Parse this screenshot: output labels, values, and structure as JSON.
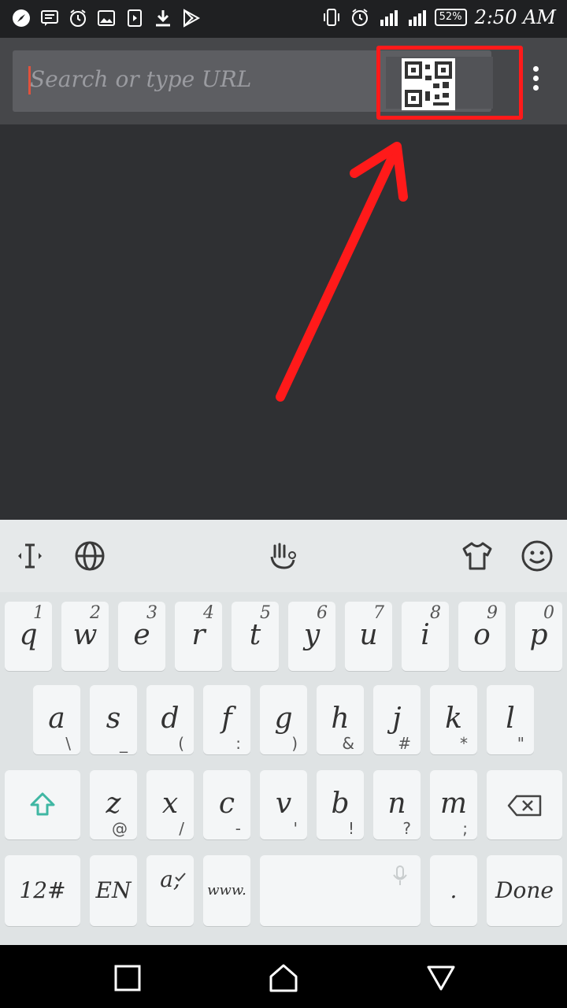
{
  "status_bar": {
    "left_icons": [
      "compass-icon",
      "message-icon",
      "alarm-icon",
      "image-icon",
      "media-icon",
      "download-icon",
      "play-store-icon"
    ],
    "battery": "52%",
    "time": "2:50 AM"
  },
  "browser": {
    "url_placeholder": "Search or type URL"
  },
  "keyboard": {
    "toolbar_icons": [
      "cursor-icon",
      "globe-icon",
      "swipe-hand-icon",
      "theme-shirt-icon",
      "emoji-icon"
    ],
    "row1": [
      {
        "main": "q",
        "sub": "1"
      },
      {
        "main": "w",
        "sub": "2"
      },
      {
        "main": "e",
        "sub": "3"
      },
      {
        "main": "r",
        "sub": "4"
      },
      {
        "main": "t",
        "sub": "5"
      },
      {
        "main": "y",
        "sub": "6"
      },
      {
        "main": "u",
        "sub": "7"
      },
      {
        "main": "i",
        "sub": "8"
      },
      {
        "main": "o",
        "sub": "9"
      },
      {
        "main": "p",
        "sub": "0"
      }
    ],
    "row2": [
      {
        "main": "a",
        "sub": "\\"
      },
      {
        "main": "s",
        "sub": "_"
      },
      {
        "main": "d",
        "sub": "("
      },
      {
        "main": "f",
        "sub": ":"
      },
      {
        "main": "g",
        "sub": ")"
      },
      {
        "main": "h",
        "sub": "&"
      },
      {
        "main": "j",
        "sub": "#"
      },
      {
        "main": "k",
        "sub": "*"
      },
      {
        "main": "l",
        "sub": "\""
      }
    ],
    "row3": [
      {
        "main": "z",
        "sub": "@"
      },
      {
        "main": "x",
        "sub": "/"
      },
      {
        "main": "c",
        "sub": "-"
      },
      {
        "main": "v",
        "sub": "'"
      },
      {
        "main": "b",
        "sub": "!"
      },
      {
        "main": "n",
        "sub": "?"
      },
      {
        "main": "m",
        "sub": ";"
      }
    ],
    "num_key": "12#",
    "lang_key": "EN",
    "suggest_key": "a,",
    "www_key": "www.",
    "period_key": ".",
    "done_key": "Done"
  },
  "nav_bar": {
    "buttons": [
      "recents-button",
      "home-button",
      "back-button"
    ]
  },
  "annotation_color": "#ff1a1a"
}
